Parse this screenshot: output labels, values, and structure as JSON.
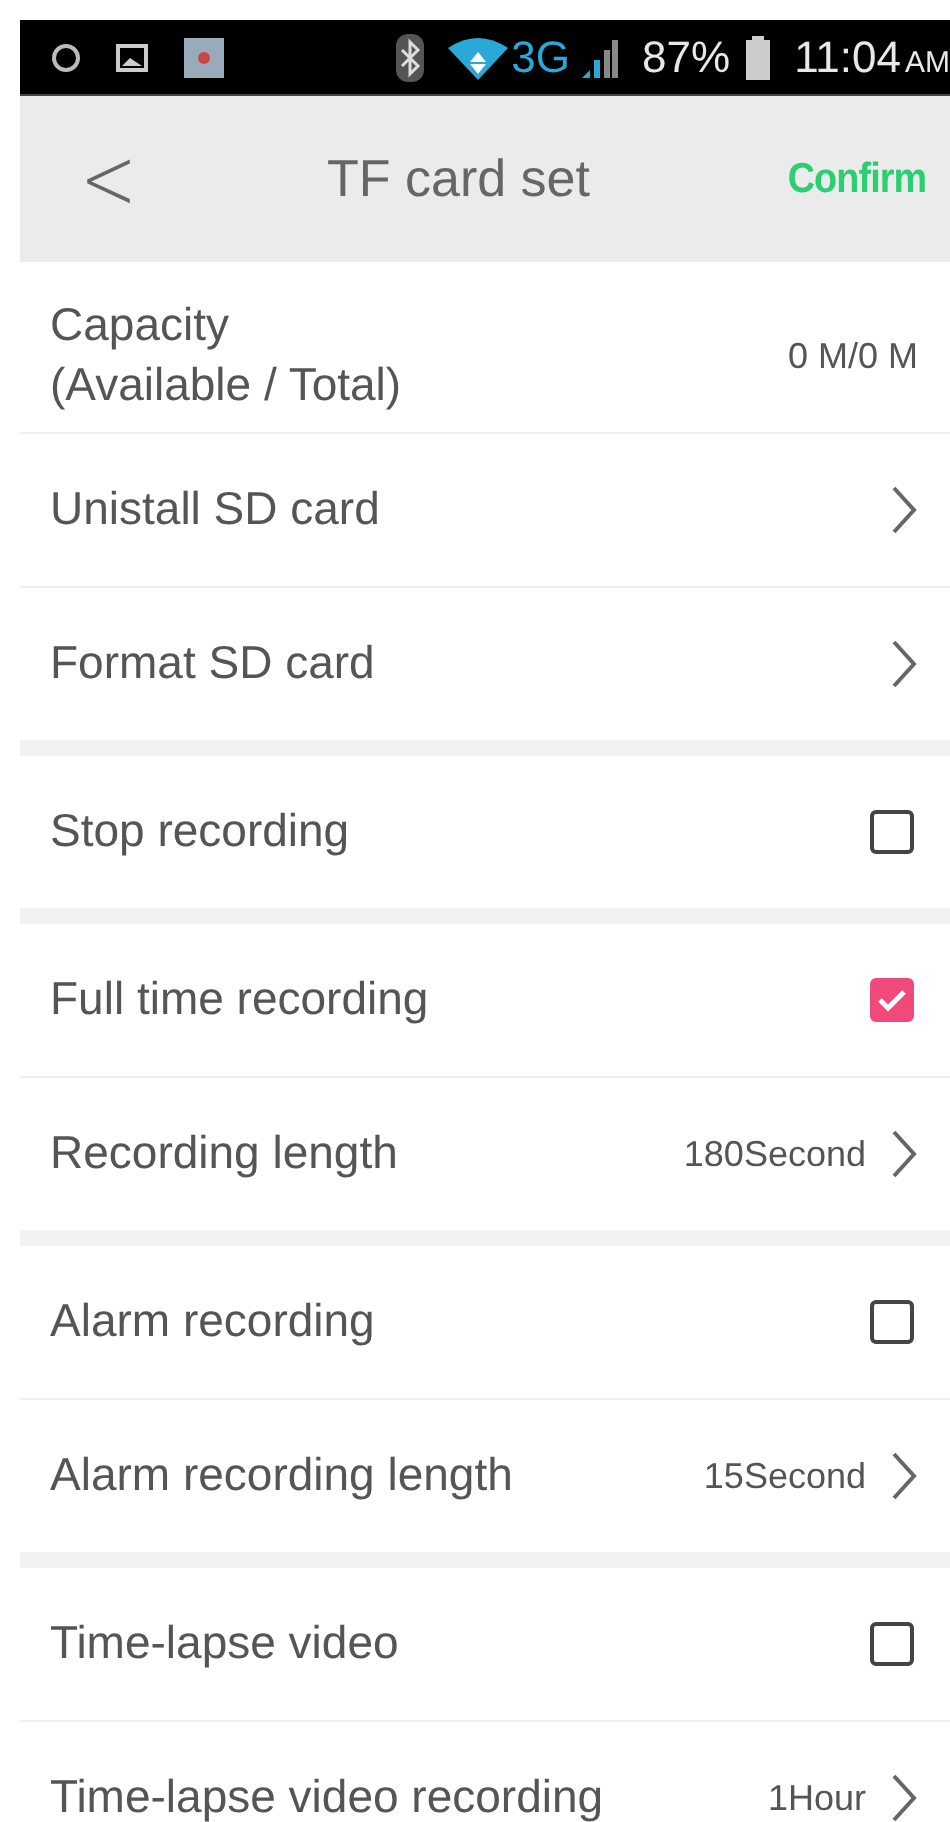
{
  "status_bar": {
    "network": "3G",
    "battery": "87%",
    "time": "11:04",
    "meridiem": "AM"
  },
  "header": {
    "back": "<",
    "title": "TF card set",
    "action": "Confirm"
  },
  "groups": [
    {
      "rows": [
        {
          "kind": "info",
          "label": "Capacity\n(Available / Total)",
          "value": "0 M/0 M"
        },
        {
          "kind": "link",
          "label": "Unistall SD card"
        },
        {
          "kind": "link",
          "label": "Format SD card"
        }
      ]
    },
    {
      "rows": [
        {
          "kind": "checkbox",
          "label": "Stop recording",
          "checked": false
        }
      ]
    },
    {
      "rows": [
        {
          "kind": "checkbox",
          "label": "Full time recording",
          "checked": true
        },
        {
          "kind": "link",
          "label": "Recording length",
          "value": "180Second"
        }
      ]
    },
    {
      "rows": [
        {
          "kind": "checkbox",
          "label": "Alarm recording",
          "checked": false
        },
        {
          "kind": "link",
          "label": "Alarm recording length",
          "value": "15Second"
        }
      ]
    },
    {
      "rows": [
        {
          "kind": "checkbox",
          "label": "Time-lapse video",
          "checked": false
        },
        {
          "kind": "link",
          "label": "Time-lapse video recording",
          "value": "1Hour"
        }
      ]
    }
  ]
}
